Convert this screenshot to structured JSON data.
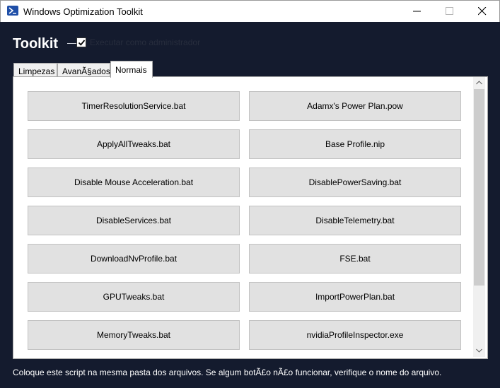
{
  "window": {
    "title": "Windows Optimization Toolkit",
    "icon": "powershell-icon"
  },
  "header": {
    "title": "Toolkit",
    "admin_checkbox": {
      "label": "Executar como administrador",
      "checked": true
    }
  },
  "tabs": [
    {
      "label": "Limpezas",
      "selected": false
    },
    {
      "label": "AvanÃ§ados",
      "selected": false
    },
    {
      "label": "Normais",
      "selected": true
    }
  ],
  "buttons": [
    "TimerResolutionService.bat",
    "Adamx's Power Plan.pow",
    "ApplyAllTweaks.bat",
    "Base Profile.nip",
    "Disable Mouse Acceleration.bat",
    "DisablePowerSaving.bat",
    "DisableServices.bat",
    "DisableTelemetry.bat",
    "DownloadNvProfile.bat",
    "FSE.bat",
    "GPUTweaks.bat",
    "ImportPowerPlan.bat",
    "MemoryTweaks.bat",
    "nvidiaProfileInspector.exe"
  ],
  "footer": {
    "text": "Coloque este script na mesma pasta dos arquivos. Se algum botÃ£o nÃ£o funcionar, verifique o nome do arquivo."
  },
  "colors": {
    "background": "#141b2e",
    "button": "#e1e1e1",
    "panel": "#ffffff"
  }
}
